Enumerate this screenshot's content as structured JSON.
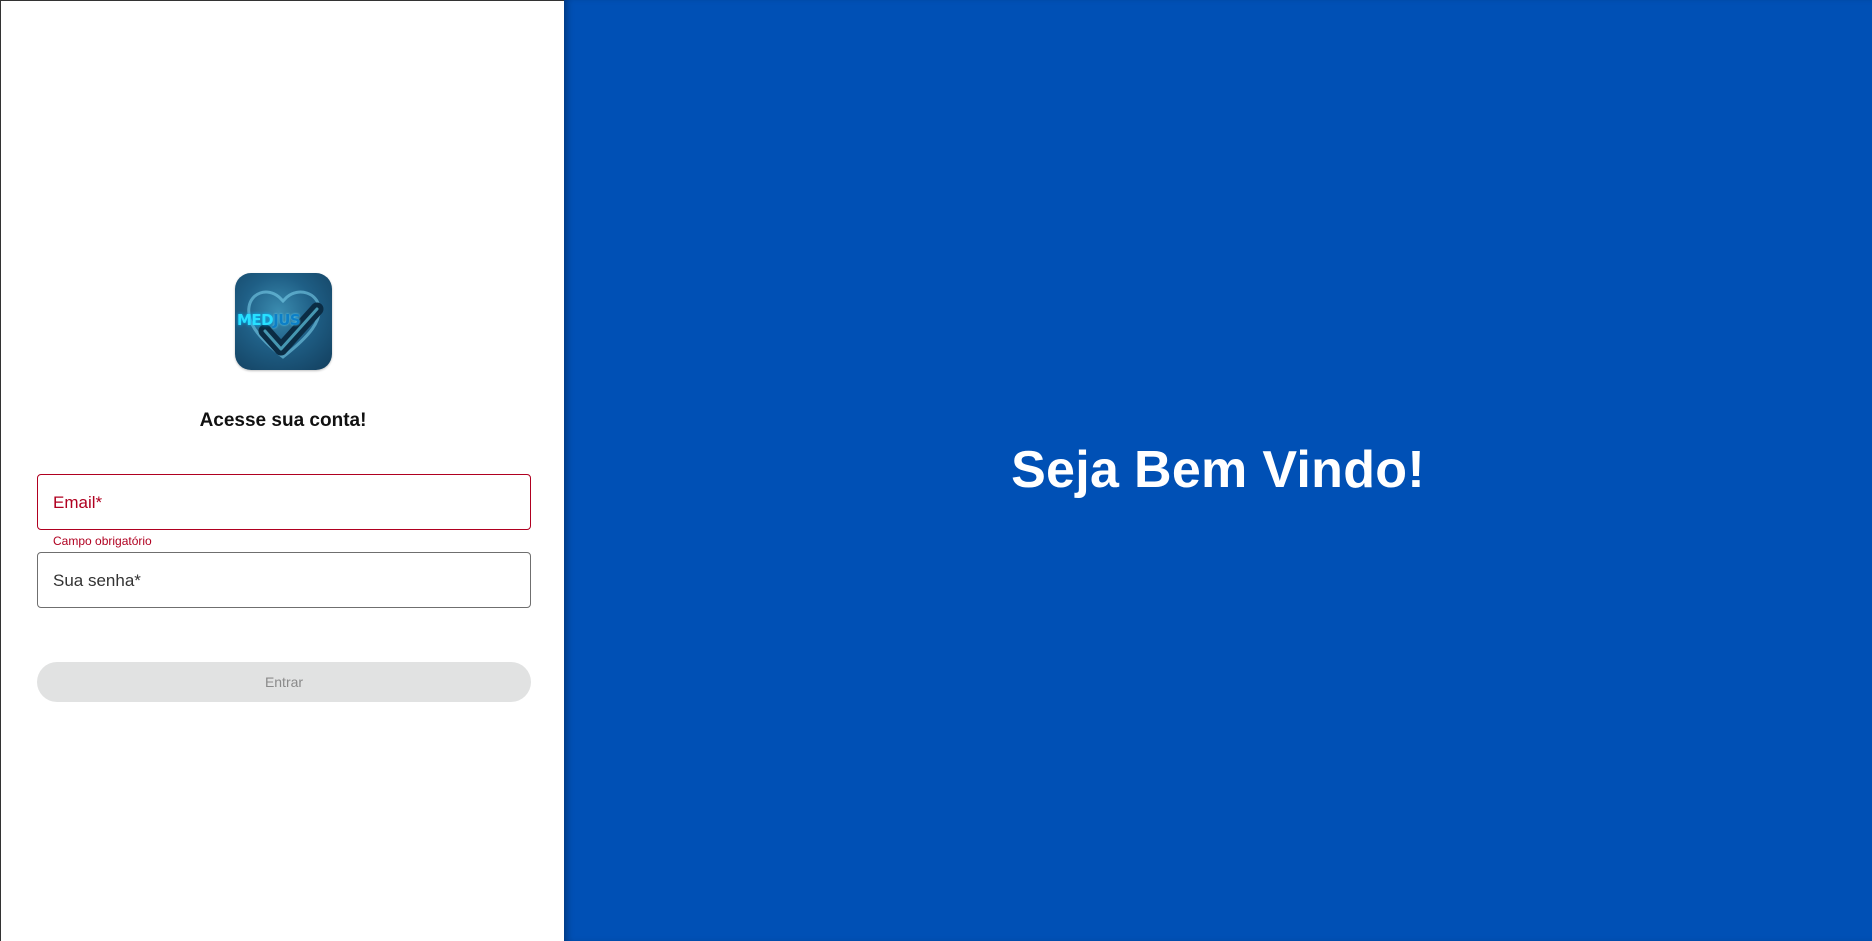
{
  "logo": {
    "text_part1": "MED",
    "text_part2": "JUS"
  },
  "login": {
    "heading": "Acesse sua conta!",
    "email_label": "Email*",
    "email_error": "Campo obrigatório",
    "password_label": "Sua senha*",
    "submit_label": "Entrar"
  },
  "welcome": {
    "title": "Seja Bem Vindo!"
  },
  "colors": {
    "right_panel_bg": "#0050b5",
    "error": "#b00020",
    "button_disabled_bg": "#e1e2e2"
  }
}
